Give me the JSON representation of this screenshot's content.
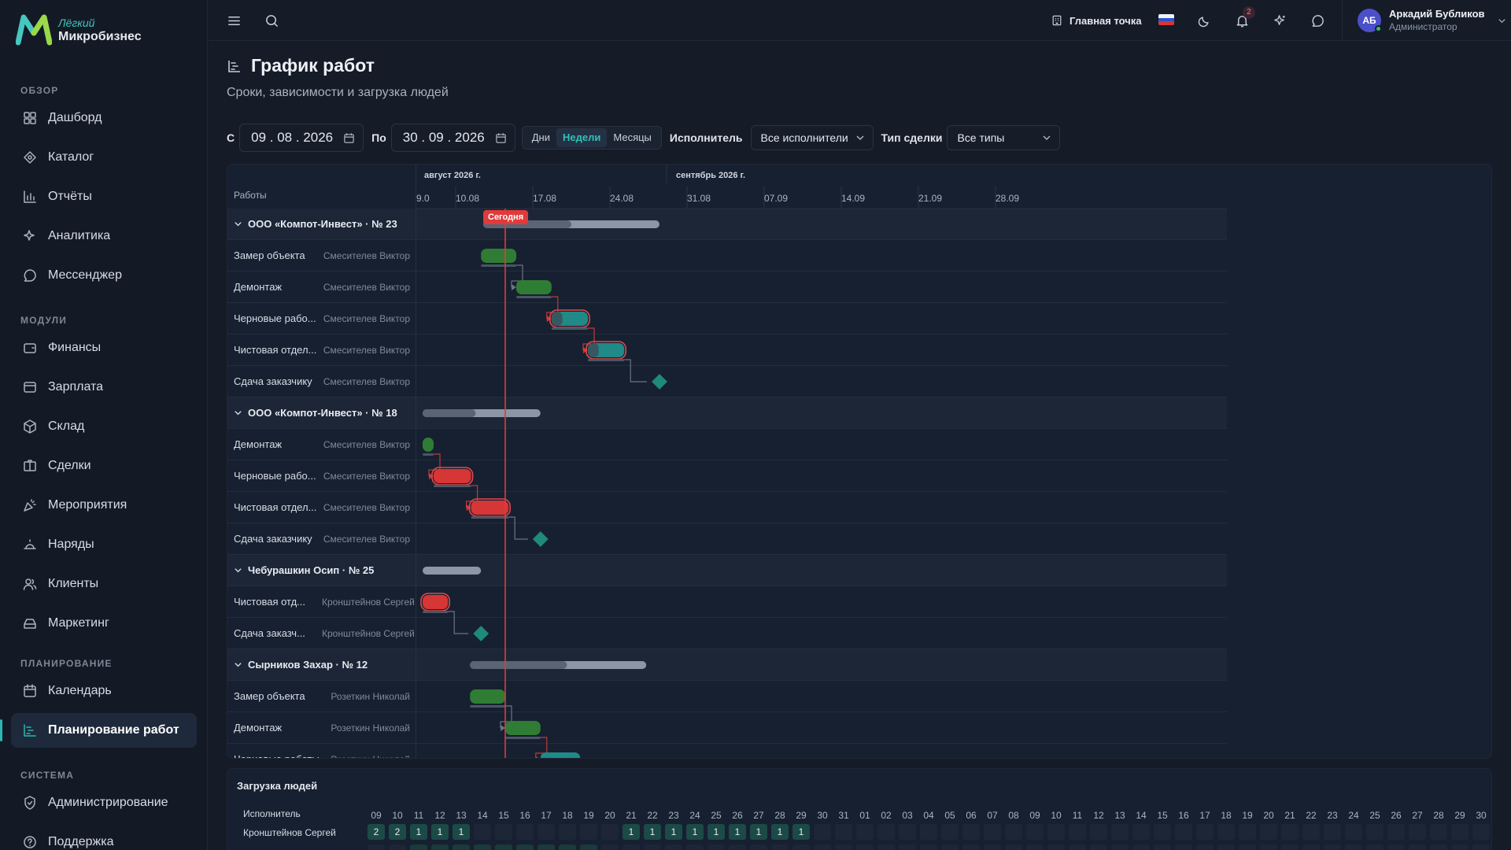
{
  "brand": {
    "line1": "Лёгкий",
    "line2": "Микробизнес"
  },
  "sidebar": {
    "sections": [
      {
        "title": "ОБЗОР",
        "items": [
          {
            "label": "Дашборд",
            "icon": "dashboard-icon"
          },
          {
            "label": "Каталог",
            "icon": "catalog-icon"
          },
          {
            "label": "Отчёты",
            "icon": "reports-icon"
          },
          {
            "label": "Аналитика",
            "icon": "analytics-icon"
          },
          {
            "label": "Мессенджер",
            "icon": "messenger-icon"
          }
        ]
      },
      {
        "title": "МОДУЛИ",
        "items": [
          {
            "label": "Финансы",
            "icon": "finance-icon"
          },
          {
            "label": "Зарплата",
            "icon": "salary-icon"
          },
          {
            "label": "Склад",
            "icon": "warehouse-icon"
          },
          {
            "label": "Сделки",
            "icon": "deals-icon"
          },
          {
            "label": "Мероприятия",
            "icon": "events-icon"
          },
          {
            "label": "Наряды",
            "icon": "orders-icon"
          },
          {
            "label": "Клиенты",
            "icon": "clients-icon"
          },
          {
            "label": "Маркетинг",
            "icon": "marketing-icon"
          }
        ]
      },
      {
        "title": "ПЛАНИРОВАНИЕ",
        "items": [
          {
            "label": "Календарь",
            "icon": "calendar-icon"
          },
          {
            "label": "Планирование работ",
            "icon": "planning-icon",
            "active": true
          }
        ]
      },
      {
        "title": "СИСТЕМА",
        "items": [
          {
            "label": "Администрирование",
            "icon": "admin-icon"
          },
          {
            "label": "Поддержка",
            "icon": "support-icon"
          }
        ]
      }
    ]
  },
  "topbar": {
    "location": "Главная точка",
    "notifications": "2",
    "user": {
      "initials": "АБ",
      "name": "Аркадий Бубликов",
      "role": "Администратор"
    }
  },
  "page": {
    "title": "График работ",
    "subtitle": "Сроки, зависимости и загрузка людей"
  },
  "filters": {
    "from_label": "С",
    "from_date": "09 . 08 . 2026",
    "to_label": "По",
    "to_date": "30 . 09 . 2026",
    "scale": [
      "Дни",
      "Недели",
      "Месяцы"
    ],
    "scale_active": 1,
    "executor_label": "Исполнитель",
    "executor_value": "Все исполнители",
    "deal_type_label": "Тип сделки",
    "deal_type_value": "Все типы"
  },
  "gantt": {
    "col_header": "Работы",
    "months": [
      {
        "label": "август 2026 г."
      },
      {
        "label": "сентябрь 2026 г."
      }
    ],
    "weeks": [
      "9.0",
      "10.08",
      "17.08",
      "24.08",
      "31.08",
      "07.09",
      "14.09",
      "21.09",
      "28.09"
    ],
    "today_label": "Сегодня",
    "today_day": 7.5,
    "rows": [
      {
        "type": "group",
        "name": "ООО «Компот-Инвест» · № 23",
        "start": 5.5,
        "end": 21.5,
        "progress": 0.5
      },
      {
        "type": "task",
        "name": "Замер объекта",
        "person": "Смесителев Виктор",
        "start": 5.3,
        "end": 8.5,
        "color": "green"
      },
      {
        "type": "task",
        "name": "Демонтаж",
        "person": "Смесителев Виктор",
        "start": 8.5,
        "end": 11.7,
        "color": "green"
      },
      {
        "type": "task",
        "name": "Черновые рабо...",
        "person": "Смесителев Виктор",
        "start": 11.7,
        "end": 15.0,
        "color": "teal",
        "late": true
      },
      {
        "type": "task",
        "name": "Чистовая отдел...",
        "person": "Смесителев Виктор",
        "start": 15.0,
        "end": 18.3,
        "color": "teal",
        "late": true
      },
      {
        "type": "milestone",
        "name": "Сдача заказчику",
        "person": "Смесителев Виктор",
        "at": 21.5
      },
      {
        "type": "group",
        "name": "ООО «Компот-Инвест» · № 18",
        "start": 0,
        "end": 10.7,
        "progress": 0.45
      },
      {
        "type": "task",
        "name": "Демонтаж",
        "person": "Смесителев Виктор",
        "start": 0,
        "end": 1.0,
        "color": "green"
      },
      {
        "type": "task",
        "name": "Черновые рабо...",
        "person": "Смесителев Виктор",
        "start": 1.0,
        "end": 4.4,
        "color": "red"
      },
      {
        "type": "task",
        "name": "Чистовая отдел...",
        "person": "Смесителев Виктор",
        "start": 4.4,
        "end": 7.8,
        "color": "red"
      },
      {
        "type": "milestone",
        "name": "Сдача заказчику",
        "person": "Смесителев Виктор",
        "at": 10.7
      },
      {
        "type": "group",
        "name": "Чебурашкин Осип · № 25",
        "start": 0,
        "end": 5.3,
        "progress": 0
      },
      {
        "type": "task",
        "name": "Чистовая отд...",
        "person": "Кронштейнов Сергей",
        "start": 0,
        "end": 2.3,
        "color": "red"
      },
      {
        "type": "milestone",
        "name": "Сдача заказч...",
        "person": "Кронштейнов Сергей",
        "at": 5.3
      },
      {
        "type": "group",
        "name": "Сырников Захар · № 12",
        "start": 4.3,
        "end": 20.3,
        "progress": 0.55
      },
      {
        "type": "task",
        "name": "Замер объекта",
        "person": "Розеткин Николай",
        "start": 4.3,
        "end": 7.5,
        "color": "green"
      },
      {
        "type": "task",
        "name": "Демонтаж",
        "person": "Розеткин Николай",
        "start": 7.5,
        "end": 10.7,
        "color": "green"
      },
      {
        "type": "task",
        "name": "Черновые работы",
        "person": "Розеткин Николай",
        "start": 10.7,
        "end": 14.3,
        "color": "teal"
      }
    ]
  },
  "load": {
    "title": "Загрузка людей",
    "col_header": "Исполнитель",
    "days": [
      "09",
      "10",
      "11",
      "12",
      "13",
      "14",
      "15",
      "16",
      "17",
      "18",
      "19",
      "20",
      "21",
      "22",
      "23",
      "24",
      "25",
      "26",
      "27",
      "28",
      "29",
      "30",
      "31",
      "01",
      "02",
      "03",
      "04",
      "05",
      "06",
      "07",
      "08",
      "09",
      "10",
      "11",
      "12",
      "13",
      "14",
      "15",
      "16",
      "17",
      "18",
      "19",
      "20",
      "21",
      "22",
      "23",
      "24",
      "25",
      "26",
      "27",
      "28",
      "29",
      "30"
    ],
    "people": [
      {
        "name": "Кронштейнов Сергей",
        "values": [
          "2",
          "2",
          "1",
          "1",
          "1",
          "",
          "",
          "",
          "",
          "",
          "",
          "",
          "1",
          "1",
          "1",
          "1",
          "1",
          "1",
          "1",
          "1",
          "1",
          "",
          "",
          "",
          "",
          "",
          "",
          "",
          "",
          "",
          "",
          "",
          "",
          "",
          "",
          "",
          "",
          "",
          "",
          "",
          "",
          "",
          "",
          "",
          "",
          "",
          "",
          "",
          "",
          "",
          "",
          "",
          ""
        ]
      }
    ]
  },
  "colors": {
    "accent": "#2bb8b0",
    "today": "#e23a3a",
    "green": "#2f7d34",
    "teal": "#1f8a87",
    "red": "#d63636"
  }
}
